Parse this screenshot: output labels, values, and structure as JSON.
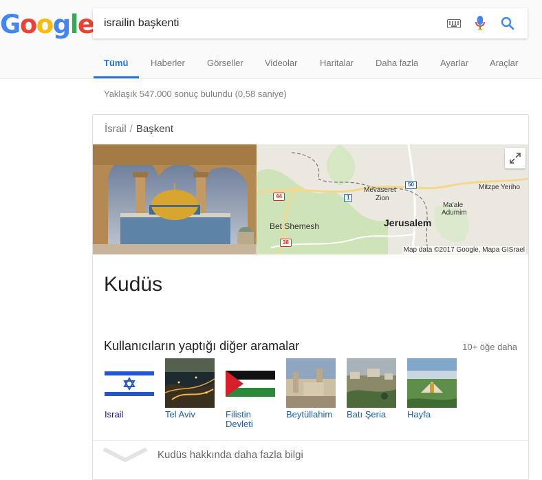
{
  "logo": {
    "text": "Google",
    "letters": [
      "G",
      "o",
      "o",
      "g",
      "l",
      "e"
    ],
    "colors": [
      "#4285f4",
      "#ea4335",
      "#fbbc05",
      "#4285f4",
      "#34a853",
      "#ea4335"
    ]
  },
  "search": {
    "query": "israilin başkenti"
  },
  "tabs": [
    "Tümü",
    "Haberler",
    "Görseller",
    "Videolar",
    "Haritalar",
    "Daha fazla",
    "Ayarlar",
    "Araçlar"
  ],
  "active_tab": "Tümü",
  "results_count": "Yaklaşık 547.000 sonuç bulundu (0,58 saniye)",
  "card": {
    "breadcrumb": {
      "parent": "İsrail",
      "separator": "/",
      "current": "Başkent"
    },
    "entity": "Kudüs",
    "map": {
      "labels": {
        "mevaseret": "Mevaseret",
        "zion": "Zion",
        "jerusalem": "Jerusalem",
        "bet_shemesh": "Bet Shemesh",
        "mitzpe": "Mitzpe Yeriho",
        "maale": "Ma'ale",
        "adumim": "Adumim"
      },
      "roads": {
        "r44": "44",
        "r1": "1",
        "r50": "50",
        "r38": "38"
      },
      "attribution": "Map data ©2017 Google, Mapa GISrael"
    },
    "related": {
      "heading": "Kullanıcıların yaptığı diğer aramalar",
      "more": "10+ öğe daha",
      "items": [
        {
          "label": "Israil"
        },
        {
          "label": "Tel Aviv"
        },
        {
          "label": "Filistin Devleti"
        },
        {
          "label": "Beytüllahim"
        },
        {
          "label": "Batı Şeria"
        },
        {
          "label": "Hayfa"
        }
      ]
    },
    "more_info": "Kudüs hakkında daha fazla bilgi"
  },
  "colors": {
    "accent": "#1a73e8",
    "link": "#1a0dab"
  }
}
